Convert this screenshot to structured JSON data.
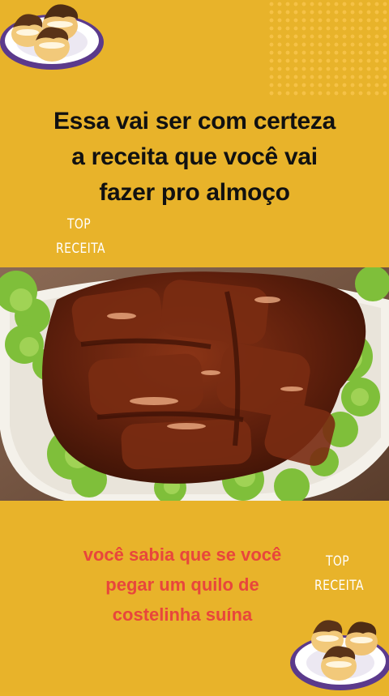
{
  "headline": {
    "line1": "Essa vai ser com certeza",
    "line2": "a receita que você vai",
    "line3": "fazer pro almoço"
  },
  "brand": {
    "line1": "TOP",
    "line2": "RECEITA"
  },
  "caption": {
    "line1": "você sabia que se você",
    "line2": "pegar um quilo de",
    "line3": "costelinha suína"
  },
  "colors": {
    "background": "#e8b32a",
    "headline": "#111111",
    "caption": "#e8463c",
    "brand": "#ffffff"
  },
  "icons": {
    "logo": "cream-puffs-plate-icon"
  }
}
